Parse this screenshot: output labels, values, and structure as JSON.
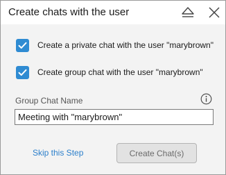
{
  "window": {
    "title": "Create chats with the user"
  },
  "options": {
    "private_chat": {
      "label": "Create a private chat with the user \"marybrown\"",
      "checked": true
    },
    "group_chat": {
      "label": "Create group chat with the user \"marybrown\"",
      "checked": true
    }
  },
  "group_chat_name": {
    "label": "Group Chat Name",
    "value": "Meeting with \"marybrown\""
  },
  "actions": {
    "skip_label": "Skip this Step",
    "create_label": "Create Chat(s)"
  },
  "colors": {
    "accent": "#2f8bd2",
    "link": "#2b7fcb",
    "dialog_bg": "#f3f3f3"
  },
  "icons": {
    "collapse": "eject-icon",
    "close": "close-icon",
    "info": "info-icon",
    "check": "checkmark-icon"
  }
}
